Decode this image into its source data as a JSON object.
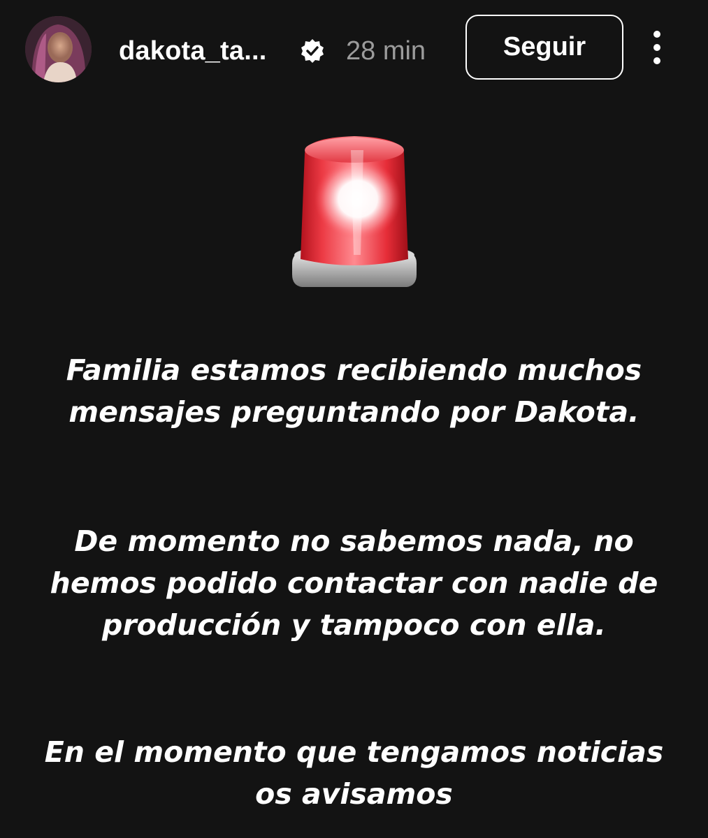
{
  "header": {
    "username": "dakota_ta...",
    "verified_icon": "verified-badge-icon",
    "time_ago": "28 min",
    "follow_label": "Seguir",
    "more_icon": "more-options-icon"
  },
  "story": {
    "emoji": "police-car-light-icon",
    "paragraphs": [
      "Familia estamos recibiendo muchos mensajes preguntando por Dakota.",
      "De momento no sabemos nada, no hemos podido contactar con nadie de producción y tampoco con ella.",
      "En el momento que tengamos noticias os avisamos"
    ]
  },
  "colors": {
    "background": "#131313",
    "text": "#ffffff",
    "muted": "#9c9c9c",
    "siren_red": "#e8323a"
  }
}
